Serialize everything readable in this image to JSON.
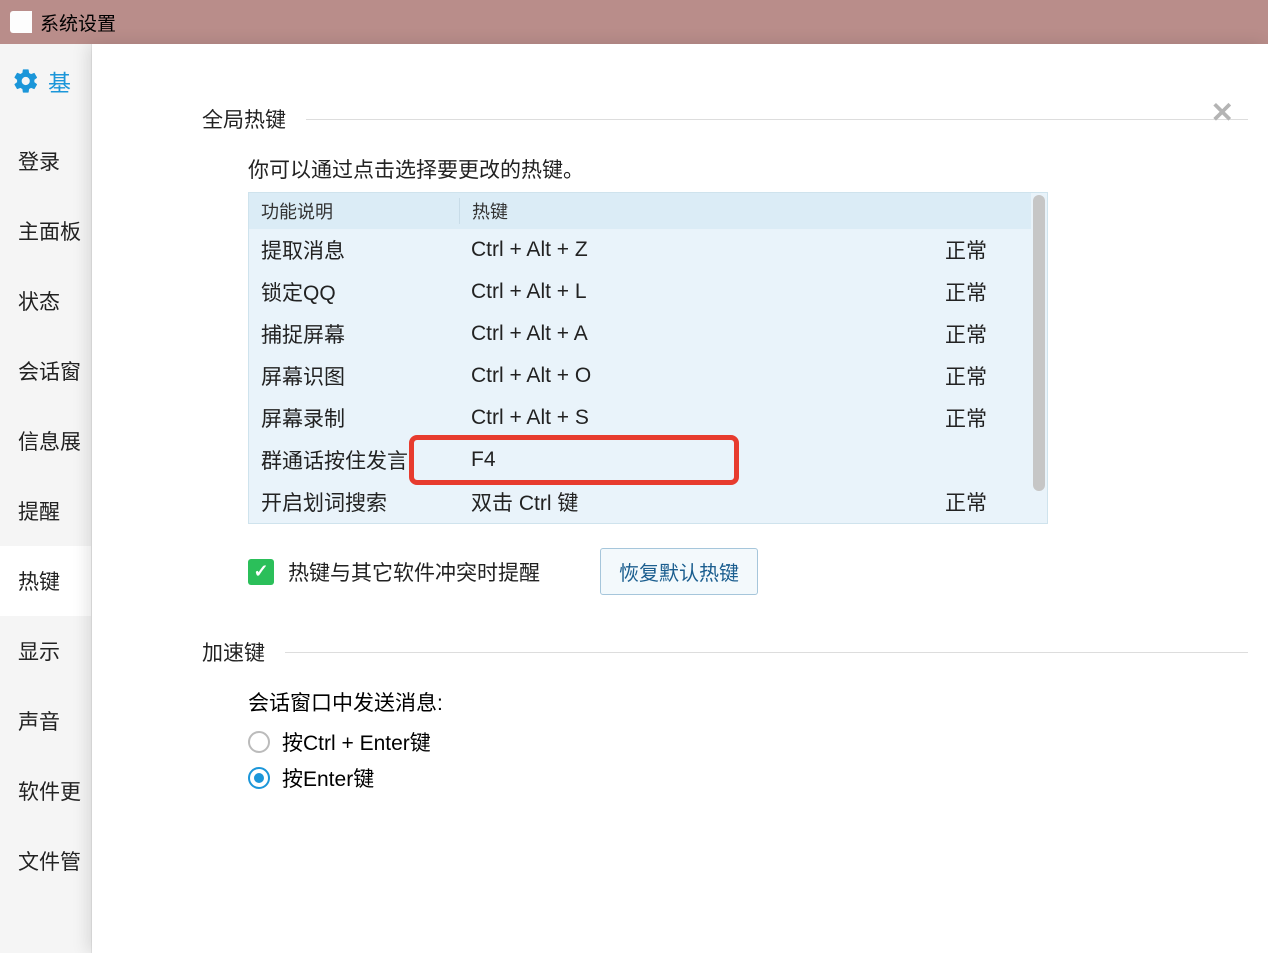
{
  "window": {
    "title": "系统设置"
  },
  "sidebar": {
    "header": "基",
    "items": [
      {
        "label": "登录"
      },
      {
        "label": "主面板"
      },
      {
        "label": "状态"
      },
      {
        "label": "会话窗"
      },
      {
        "label": "信息展"
      },
      {
        "label": "提醒"
      },
      {
        "label": "热键"
      },
      {
        "label": "显示"
      },
      {
        "label": "声音"
      },
      {
        "label": "软件更"
      },
      {
        "label": "文件管"
      }
    ],
    "active_index": 6
  },
  "panel": {
    "close_glyph": "✕",
    "section_global_title": "全局热键",
    "hint": "你可以通过点击选择要更改的热键。",
    "table": {
      "header_func": "功能说明",
      "header_key": "热键",
      "rows": [
        {
          "func": "提取消息",
          "key": "Ctrl + Alt + Z",
          "status": "正常"
        },
        {
          "func": "锁定QQ",
          "key": "Ctrl + Alt + L",
          "status": "正常"
        },
        {
          "func": "捕捉屏幕",
          "key": "Ctrl + Alt + A",
          "status": "正常"
        },
        {
          "func": "屏幕识图",
          "key": "Ctrl + Alt + O",
          "status": "正常"
        },
        {
          "func": "屏幕录制",
          "key": "Ctrl + Alt + S",
          "status": "正常"
        },
        {
          "func": "群通话按住发言",
          "key": "F4",
          "status": ""
        },
        {
          "func": "开启划词搜索",
          "key": "双击 Ctrl 键",
          "status": "正常"
        }
      ],
      "highlight_row_index": 5
    },
    "conflict_checkbox_label": "热键与其它软件冲突时提醒",
    "conflict_checked": true,
    "restore_button": "恢复默认热键",
    "section_accel_title": "加速键",
    "send_label": "会话窗口中发送消息:",
    "radio_options": [
      {
        "label": "按Ctrl + Enter键",
        "selected": false
      },
      {
        "label": "按Enter键",
        "selected": true
      }
    ]
  }
}
